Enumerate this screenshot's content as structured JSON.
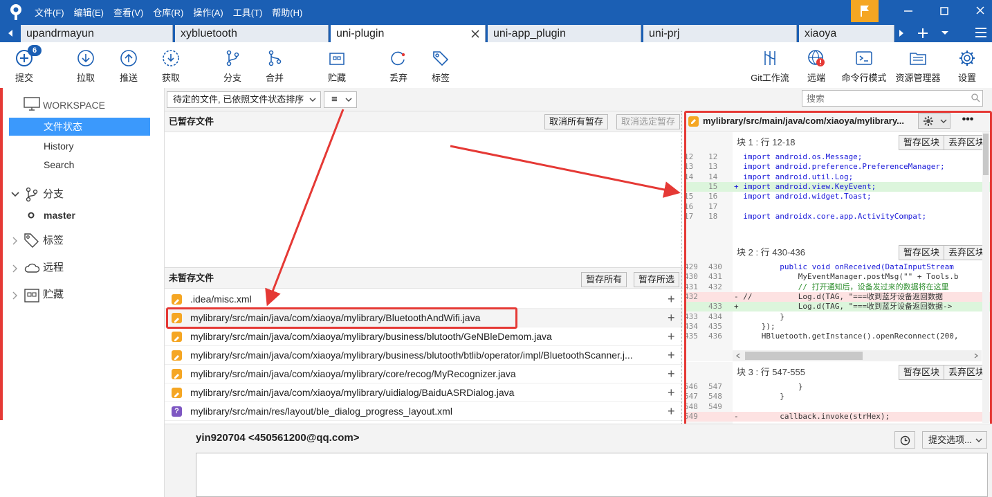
{
  "menu": [
    "文件(F)",
    "编辑(E)",
    "查看(V)",
    "仓库(R)",
    "操作(A)",
    "工具(T)",
    "帮助(H)"
  ],
  "tabs": [
    {
      "label": "upandrmayun"
    },
    {
      "label": "xybluetooth"
    },
    {
      "label": "uni-plugin"
    },
    {
      "label": "uni-app_plugin"
    },
    {
      "label": "uni-prj"
    },
    {
      "label": "xiaoya"
    }
  ],
  "toolbar": {
    "commit": "提交",
    "commit_badge": "6",
    "pull": "拉取",
    "push": "推送",
    "fetch": "获取",
    "branch": "分支",
    "merge": "合并",
    "stash": "贮藏",
    "discard": "丢弃",
    "tag": "标签",
    "gitflow": "Git工作流",
    "remote": "远端",
    "terminal": "命令行模式",
    "explorer": "资源管理器",
    "settings": "设置"
  },
  "sidebar": {
    "workspace": "WORKSPACE",
    "file_status": "文件状态",
    "history": "History",
    "search": "Search",
    "branches": "分支",
    "master": "master",
    "tags": "标签",
    "remotes": "远程",
    "stashes": "贮藏"
  },
  "filter": {
    "sort_label": "待定的文件, 已依照文件状态排序",
    "view_icon": "≡"
  },
  "search": {
    "placeholder": "搜索"
  },
  "staged": {
    "title": "已暂存文件",
    "unstage_all": "取消所有暂存",
    "unstage_selected": "取消选定暂存"
  },
  "unstaged": {
    "title": "未暂存文件",
    "stage_all": "暂存所有",
    "stage_selected": "暂存所选",
    "files": [
      {
        "path": ".idea/misc.xml",
        "status": "modified"
      },
      {
        "path": "mylibrary/src/main/java/com/xiaoya/mylibrary/BluetoothAndWifi.java",
        "status": "modified"
      },
      {
        "path": "mylibrary/src/main/java/com/xiaoya/mylibrary/business/blutooth/GeNBleDemom.java",
        "status": "modified"
      },
      {
        "path": "mylibrary/src/main/java/com/xiaoya/mylibrary/business/blutooth/btlib/operator/impl/BluetoothScanner.j...",
        "status": "modified"
      },
      {
        "path": "mylibrary/src/main/java/com/xiaoya/mylibrary/core/recog/MyRecognizer.java",
        "status": "modified"
      },
      {
        "path": "mylibrary/src/main/java/com/xiaoya/mylibrary/uidialog/BaiduASRDialog.java",
        "status": "modified"
      },
      {
        "path": "mylibrary/src/main/res/layout/ble_dialog_progress_layout.xml",
        "status": "untracked"
      }
    ]
  },
  "diff": {
    "file_title": "mylibrary/src/main/java/com/xiaoya/mylibrary...",
    "stash_hunk": "暂存区块",
    "discard_hunk": "丢弃区块",
    "hunks": [
      {
        "title": "块 1 : 行 12-18",
        "lines": [
          {
            "o": "12",
            "n": "12",
            "t": "ctx",
            "s": "import android.os.Message;"
          },
          {
            "o": "13",
            "n": "13",
            "t": "ctx",
            "s": "import android.preference.PreferenceManager;"
          },
          {
            "o": "14",
            "n": "14",
            "t": "ctx",
            "s": "import android.util.Log;"
          },
          {
            "o": "",
            "n": "15",
            "t": "add",
            "s": "import android.view.KeyEvent;"
          },
          {
            "o": "15",
            "n": "16",
            "t": "ctx",
            "s": "import android.widget.Toast;"
          },
          {
            "o": "16",
            "n": "17",
            "t": "ctx",
            "s": ""
          },
          {
            "o": "17",
            "n": "18",
            "t": "ctx",
            "s": "import androidx.core.app.ActivityCompat;"
          }
        ]
      },
      {
        "title": "块 2 : 行 430-436",
        "lines": [
          {
            "o": "429",
            "n": "430",
            "t": "ctx",
            "s": "        public void onReceived(DataInputStream"
          },
          {
            "o": "430",
            "n": "431",
            "t": "ctx",
            "s": "            MyEventManager.postMsg(\"\" + Tools.b"
          },
          {
            "o": "431",
            "n": "432",
            "t": "ctx",
            "s": "            // 打开通知后，设备发过来的数据将在这里"
          },
          {
            "o": "432",
            "n": "",
            "t": "del",
            "s": "//          Log.d(TAG, \"===收到蓝牙设备返回数据"
          },
          {
            "o": "",
            "n": "433",
            "t": "add",
            "s": "            Log.d(TAG, \"===收到蓝牙设备返回数据->"
          },
          {
            "o": "433",
            "n": "434",
            "t": "ctx",
            "s": "        }"
          },
          {
            "o": "434",
            "n": "435",
            "t": "ctx",
            "s": "    });"
          },
          {
            "o": "435",
            "n": "436",
            "t": "ctx",
            "s": "    HBluetooth.getInstance().openReconnect(200,"
          }
        ]
      },
      {
        "title": "块 3 : 行 547-555",
        "lines": [
          {
            "o": "546",
            "n": "547",
            "t": "ctx",
            "s": "            }"
          },
          {
            "o": "547",
            "n": "548",
            "t": "ctx",
            "s": "        }"
          },
          {
            "o": "548",
            "n": "549",
            "t": "ctx",
            "s": ""
          },
          {
            "o": "549",
            "n": "",
            "t": "del",
            "s": "        callback.invoke(strHex);"
          }
        ]
      }
    ]
  },
  "commit": {
    "author": "yin920704 <450561200@qq.com>",
    "options": "提交选项..."
  },
  "colors": {
    "titlebar": "#1b5fb4",
    "highlight": "#e53935",
    "selected": "#3b99fc",
    "modified": "#f5a623",
    "untracked": "#7e57c2"
  }
}
